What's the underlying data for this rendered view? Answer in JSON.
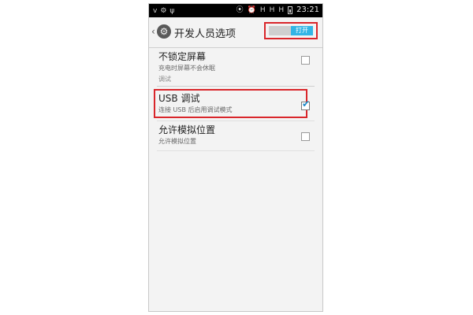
{
  "status_bar": {
    "icons_left": [
      "v",
      "⚙",
      "ψ"
    ],
    "icons_right": [
      "⦿",
      "⏰",
      "H",
      "H",
      "H"
    ],
    "time": "23:21"
  },
  "action_bar": {
    "back_glyph": "‹",
    "gear_glyph": "⚙",
    "title": "开发人员选项",
    "toggle_label": "打开"
  },
  "prefs": {
    "no_lock": {
      "title": "不锁定屏幕",
      "summary": "充电时屏幕不会休眠",
      "checked": false
    },
    "section_header": "调试",
    "usb": {
      "title": "USB 调试",
      "summary": "连接 USB 后启用调试模式",
      "checked": true
    },
    "mock_location": {
      "title": "允许模拟位置",
      "summary": "允许模拟位置",
      "checked": false
    }
  },
  "colors": {
    "highlight": "#d9262b",
    "accent": "#33b5e5",
    "check": "#1e88c8"
  }
}
